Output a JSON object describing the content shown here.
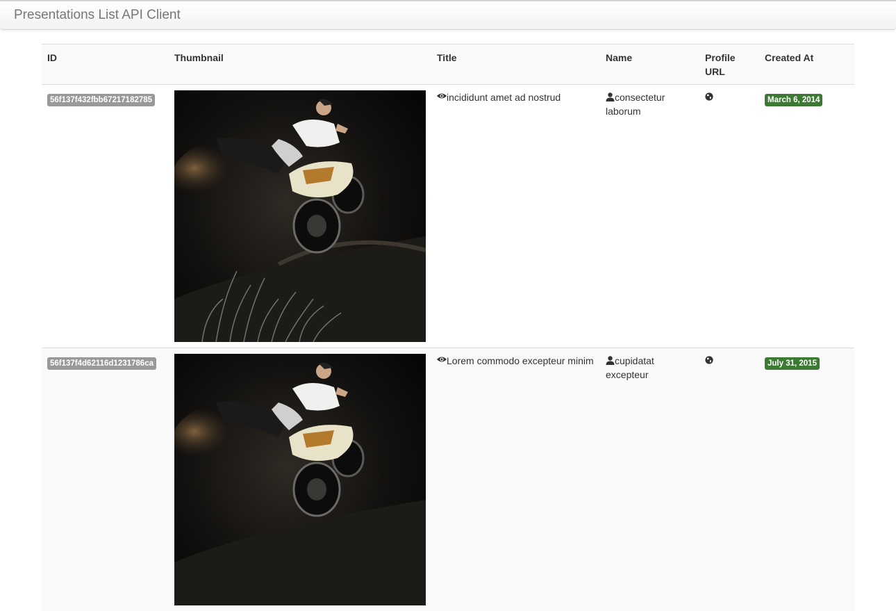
{
  "app": {
    "title": "Presentations List API Client"
  },
  "table": {
    "headers": {
      "id": "ID",
      "thumbnail": "Thumbnail",
      "title": "Title",
      "name": "Name",
      "profile_url": "Profile URL",
      "created_at": "Created At"
    },
    "rows": [
      {
        "id": "56f137f432fbb67217182785",
        "title": "incididunt amet ad nostrud",
        "name": "consectetur laborum",
        "created_at": "March 6, 2014"
      },
      {
        "id": "56f137f4d62116d1231786ca",
        "title": "Lorem commodo excepteur minim",
        "name": "cupidatat excepteur",
        "created_at": "July 31, 2015"
      }
    ]
  },
  "icons": {
    "title": "eye-icon",
    "name": "user-icon",
    "profile_url": "globe-icon"
  },
  "colors": {
    "id_label": "#999999",
    "date_label": "#3c7a34"
  }
}
